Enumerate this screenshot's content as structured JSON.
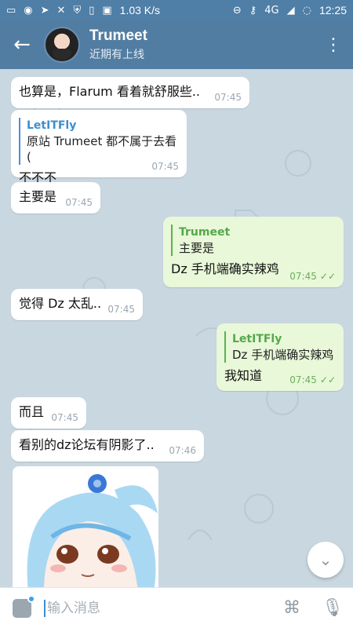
{
  "statusbar": {
    "icons": [
      "sms-icon",
      "chat-icon",
      "telegram-icon",
      "tools-icon",
      "shield-icon",
      "sim-icon",
      "image-icon"
    ],
    "speed": "1.03 K/s",
    "network": "4G",
    "time": "12:25"
  },
  "header": {
    "back_icon": "arrow-left-icon",
    "title": "Trumeet",
    "subtitle": "近期有上线",
    "menu_icon": "kebab-menu-icon"
  },
  "messages": [
    {
      "id": "m1",
      "dir": "in",
      "text": "也算是，Flarum 看着就舒服些..",
      "time": "07:45"
    },
    {
      "id": "m2",
      "dir": "in",
      "quote_name": "LetITFly",
      "quote_text": "原站 Trumeet 都不属于去看(",
      "text": "不不不",
      "time": "07:45"
    },
    {
      "id": "m3",
      "dir": "in",
      "text": "主要是",
      "time": "07:45"
    },
    {
      "id": "m4",
      "dir": "out",
      "quote_name": "Trumeet",
      "quote_text": "主要是",
      "text": "Dz 手机端确实辣鸡",
      "time": "07:45",
      "ticks": "✓✓"
    },
    {
      "id": "m5",
      "dir": "in",
      "text": "觉得 Dz 太乱..",
      "time": "07:45"
    },
    {
      "id": "m6",
      "dir": "out",
      "quote_name": "LetITFly",
      "quote_text": "Dz 手机端确实辣鸡",
      "text": "我知道",
      "time": "07:45",
      "ticks": "✓✓"
    },
    {
      "id": "m7",
      "dir": "in",
      "text": "而且",
      "time": "07:45"
    },
    {
      "id": "m8",
      "dir": "in",
      "text": "看别的dz论坛有阴影了..",
      "time": "07:46"
    }
  ],
  "composer": {
    "placeholder": "输入消息",
    "emoji_icon": "emoji-icon",
    "attach_icon": "paperclip-icon",
    "mic_icon": "microphone-icon"
  },
  "colors": {
    "header": "#527da3",
    "statusbar": "#4f7ea6",
    "incoming_bubble": "#ffffff",
    "outgoing_bubble": "#e8f8d9",
    "quote_in": "#3b8ed0",
    "quote_out": "#55a84a"
  }
}
